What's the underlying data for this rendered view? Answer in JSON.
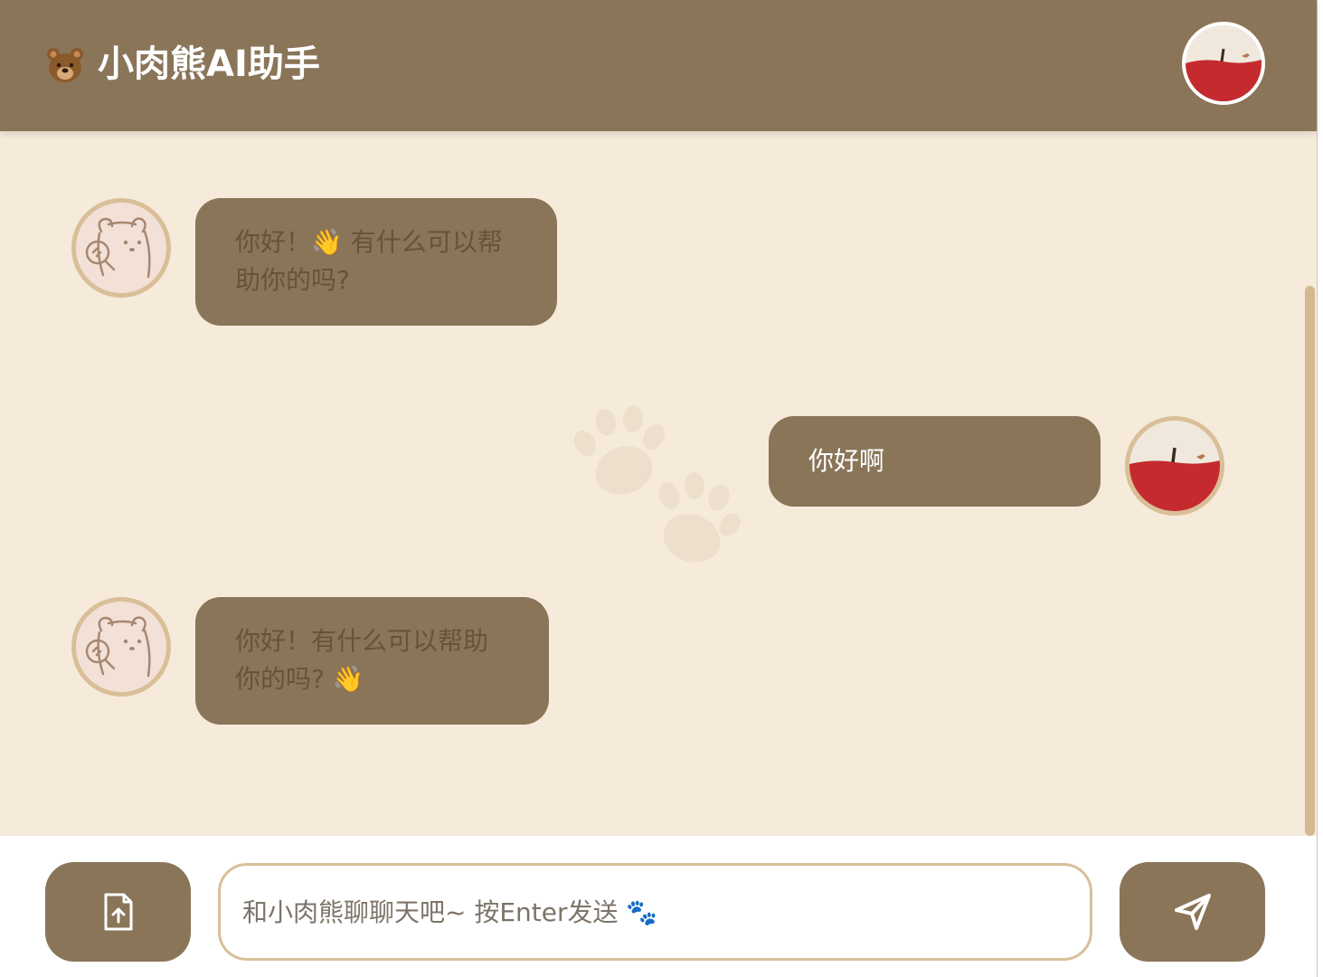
{
  "header": {
    "logo_icon": "bear-emoji-icon",
    "title": "🐻 小肉熊AI助手",
    "title_text": "小肉熊AI助手",
    "user_avatar": "apple-avatar"
  },
  "messages": [
    {
      "role": "assistant",
      "avatar": "bear-avatar",
      "text": "你好！👋 有什么可以帮助你的吗?"
    },
    {
      "role": "user",
      "avatar": "apple-avatar",
      "text": "你好啊"
    },
    {
      "role": "assistant",
      "avatar": "bear-avatar",
      "text": "你好！有什么可以帮助你的吗? 👋"
    }
  ],
  "composer": {
    "placeholder": "和小肉熊聊聊天吧~ 按Enter发送 🐾",
    "value": "",
    "upload_icon": "file-upload-icon",
    "send_icon": "send-icon"
  },
  "colors": {
    "header_bg": "#8a7559",
    "chat_bg": "#f6eadb",
    "bubble_bg": "#8a7559",
    "ai_text": "#6a5236",
    "user_text": "#ffffff",
    "avatar_ring": "#d9bf98"
  }
}
